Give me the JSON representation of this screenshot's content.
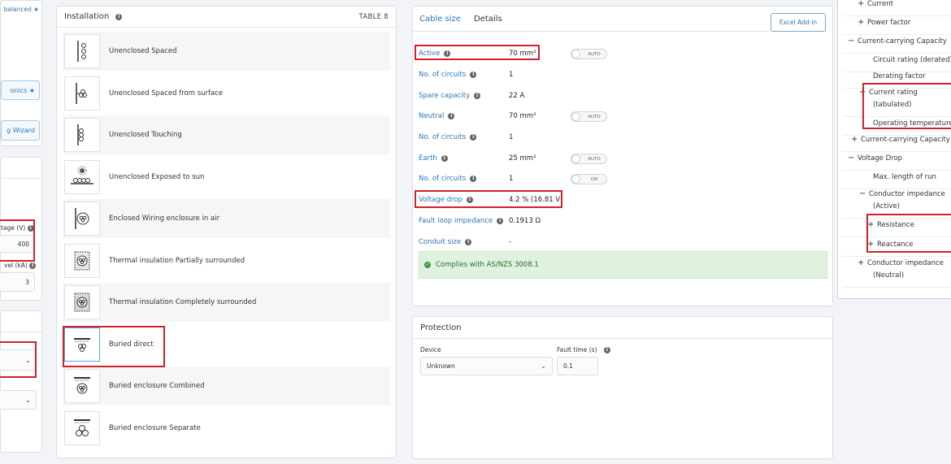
{
  "left_panel": {
    "balanced_label": "balanced ★",
    "harmonics_label": "onics ★",
    "wizard_label": "g Wizard",
    "voltage_label": "tage (V)",
    "voltage_value": "400",
    "fault_level_label": "vel (kA)",
    "fault_level_value": "3"
  },
  "installation": {
    "title": "Installation",
    "table_label": "TABLE 8",
    "items": [
      {
        "label": "Unenclosed Spaced",
        "icon": "spaced-icon"
      },
      {
        "label": "Unenclosed Spaced from surface",
        "icon": "spaced-surface-icon"
      },
      {
        "label": "Unenclosed Touching",
        "icon": "touching-icon"
      },
      {
        "label": "Unenclosed Exposed to sun",
        "icon": "sun-icon"
      },
      {
        "label": "Enclosed Wiring enclosure in air",
        "icon": "enclosure-icon"
      },
      {
        "label": "Thermal insulation Partially surrounded",
        "icon": "partial-insulation-icon"
      },
      {
        "label": "Thermal insulation Completely surrounded",
        "icon": "full-insulation-icon"
      },
      {
        "label": "Buried direct",
        "icon": "buried-direct-icon"
      },
      {
        "label": "Buried enclosure Combined",
        "icon": "buried-combined-icon"
      },
      {
        "label": "Buried enclosure Separate",
        "icon": "buried-separate-icon"
      }
    ]
  },
  "cable": {
    "tab_cable": "Cable size",
    "tab_details": "Details",
    "excel_button": "Excel Add-in",
    "rows": [
      {
        "key": "Active",
        "value": "70 mm²",
        "toggle": "AUTO"
      },
      {
        "key": "No. of circuits",
        "value": "1"
      },
      {
        "key": "Spare capacity",
        "value": "22 A"
      },
      {
        "key": "Neutral",
        "value": "70 mm²",
        "toggle": "AUTO"
      },
      {
        "key": "No. of circuits",
        "value": "1"
      },
      {
        "key": "Earth",
        "value": "25 mm²",
        "toggle": "AUTO"
      },
      {
        "key": "No. of circuits",
        "value": "1",
        "toggle": "ON"
      },
      {
        "key": "Voltage drop",
        "value": "4.2 % (16.81 V)"
      },
      {
        "key": "Fault loop impedance",
        "value": "0.1913 Ω"
      },
      {
        "key": "Conduit size",
        "value": "-"
      }
    ],
    "compliance": "Complies with AS/NZS 3008.1"
  },
  "protection": {
    "title": "Protection",
    "device_label": "Device",
    "device_value": "Unknown",
    "fault_time_label": "Fault time (s)",
    "fault_time_value": "0.1"
  },
  "tree": {
    "items": [
      {
        "sign": "+",
        "label": "Current"
      },
      {
        "sign": "+",
        "label": "Power factor"
      },
      {
        "sign": "−",
        "label": "Current-carrying Capacity"
      },
      {
        "sign": "",
        "label": "Circuit rating (derated)"
      },
      {
        "sign": "",
        "label": "Derating factor"
      },
      {
        "sign": "+",
        "label": "Current rating"
      },
      {
        "sign": "",
        "label": "(tabulated)"
      },
      {
        "sign": "",
        "label": "Operating temperature"
      },
      {
        "sign": "+",
        "label": "Current-carrying Capacity"
      },
      {
        "sign": "−",
        "label": "Voltage Drop"
      },
      {
        "sign": "",
        "label": "Max. length of run"
      },
      {
        "sign": "−",
        "label": "Conductor impedance"
      },
      {
        "sign": "",
        "label": "(Active)"
      },
      {
        "sign": "+",
        "label": "Resistance"
      },
      {
        "sign": "+",
        "label": "Reactance"
      },
      {
        "sign": "+",
        "label": "Conductor impedance"
      },
      {
        "sign": "",
        "label": "(Neutral)"
      }
    ]
  },
  "colors": {
    "accent": "#2b76b9",
    "highlight": "#d0212a",
    "success_bg": "#dff2df"
  }
}
